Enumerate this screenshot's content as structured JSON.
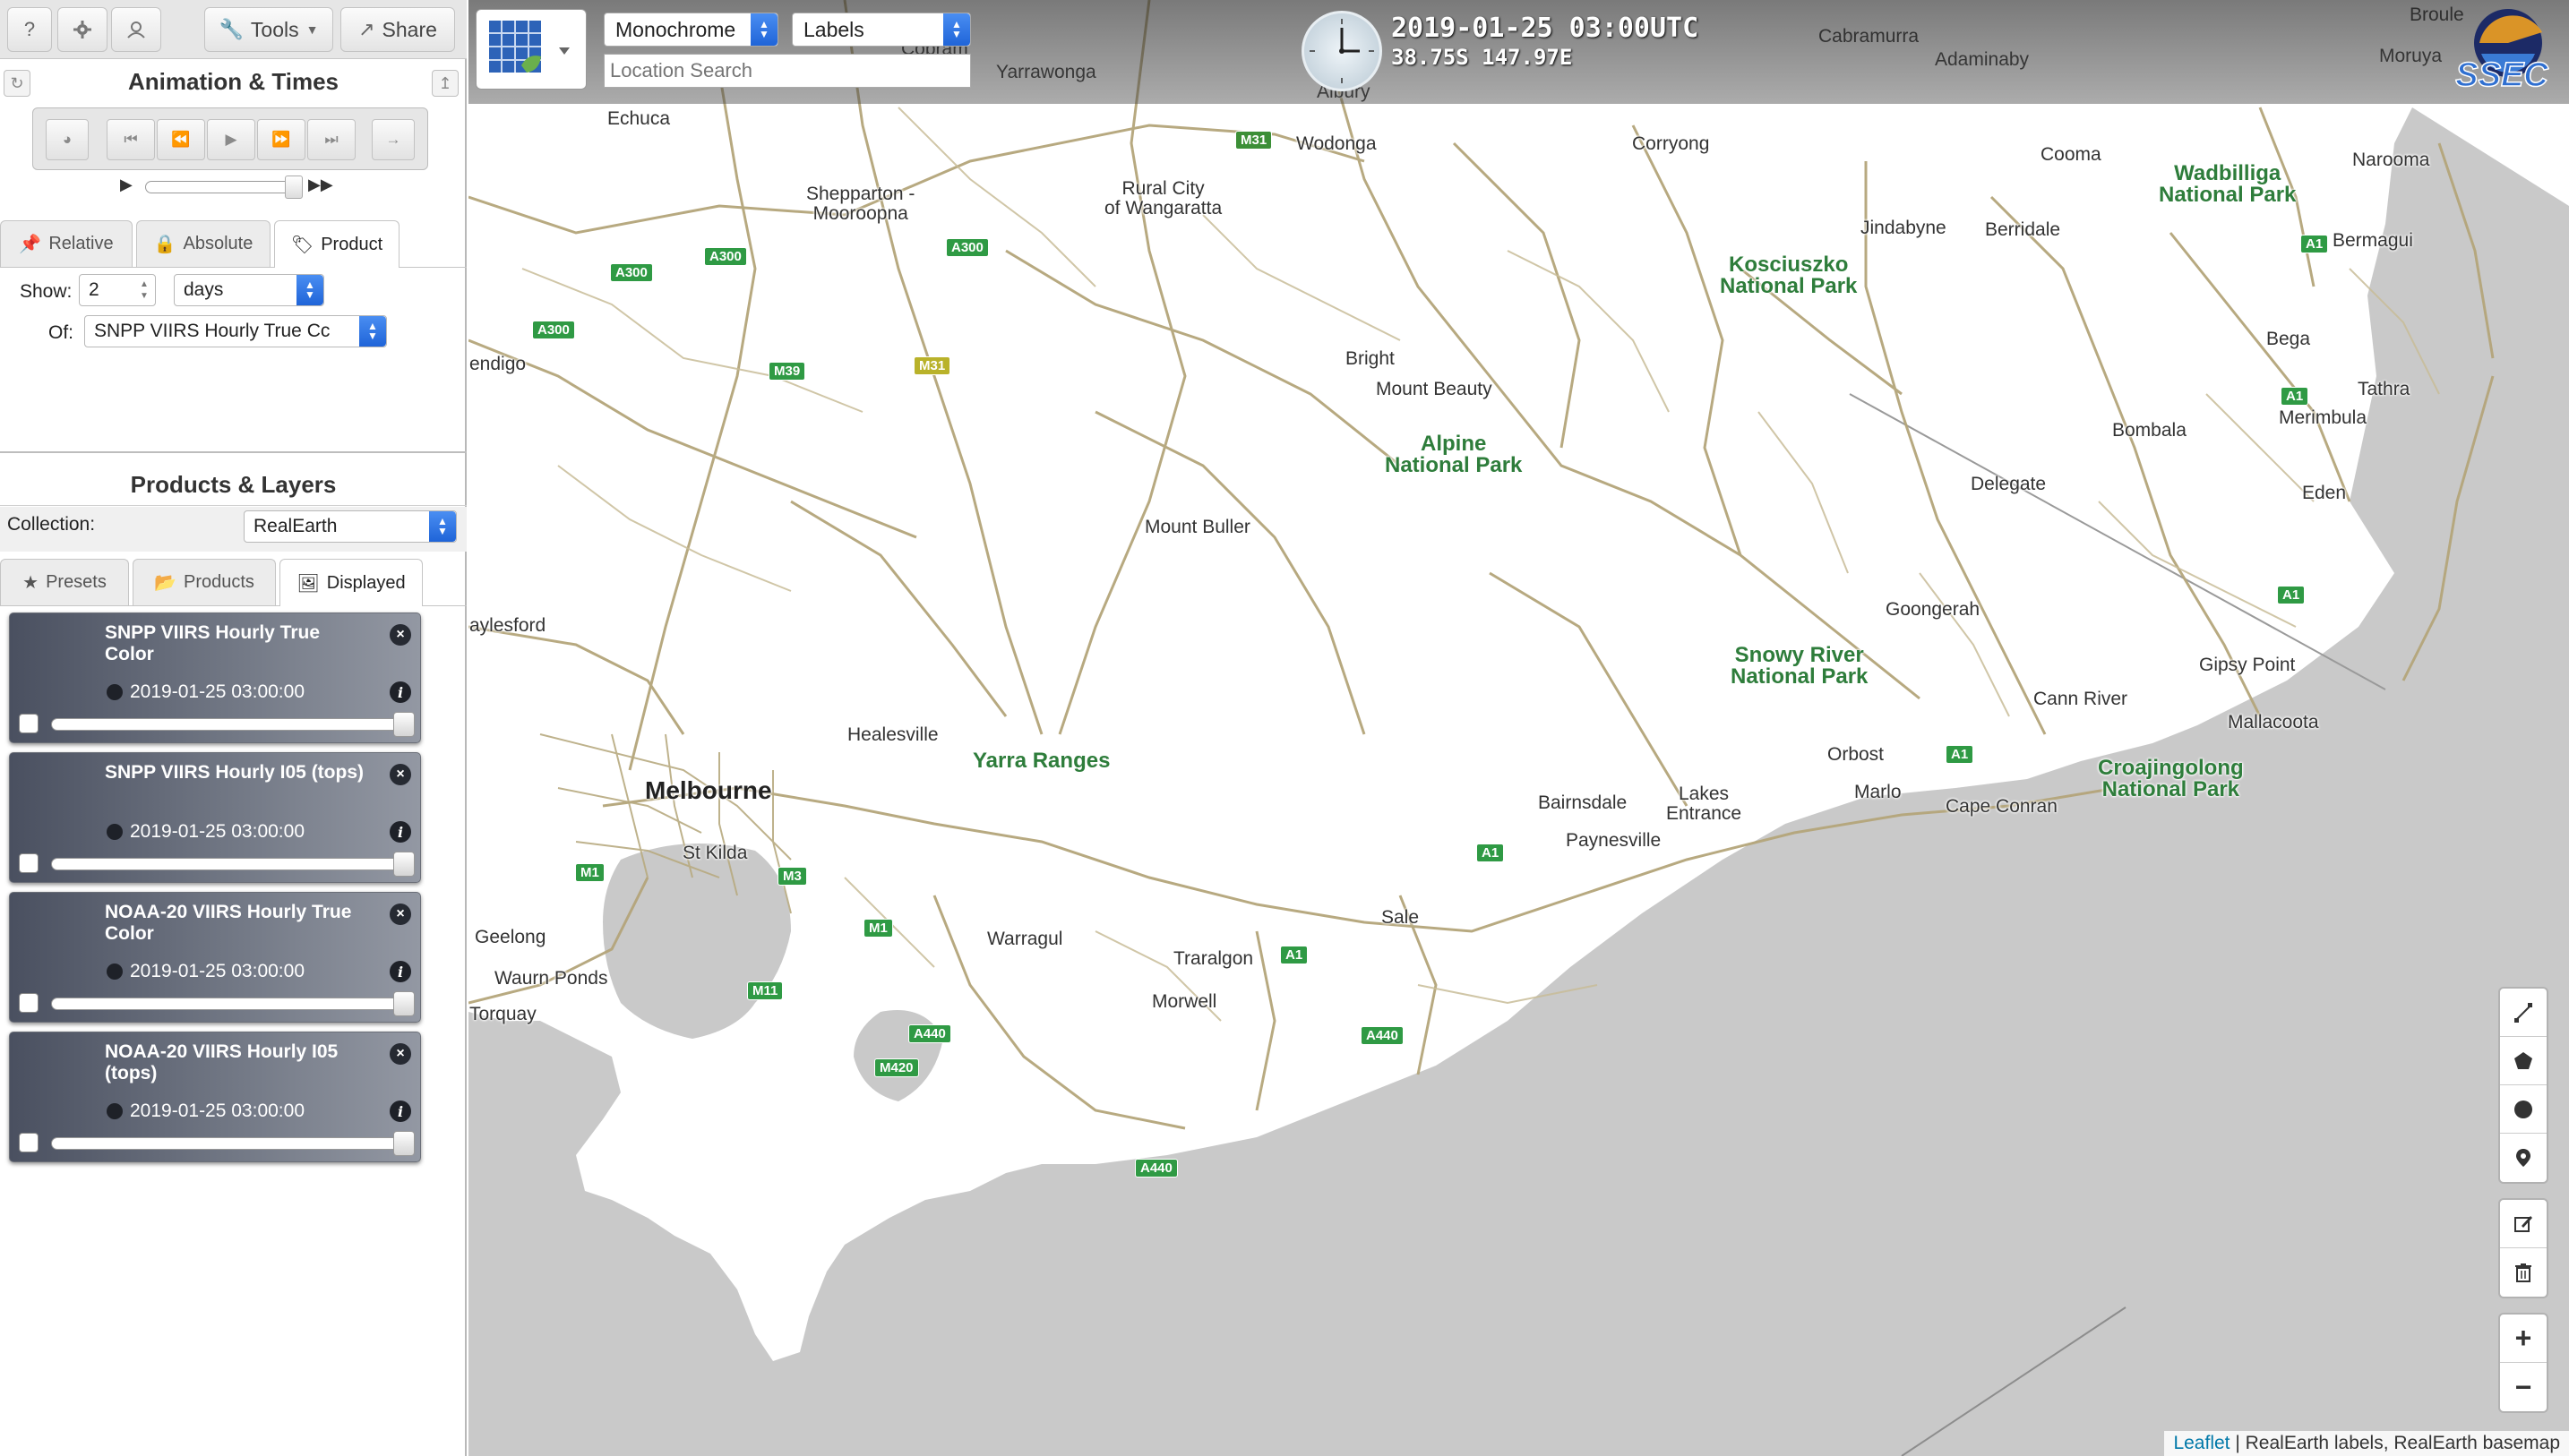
{
  "sidebar": {
    "topbar": {
      "help": "?",
      "tools": "Tools",
      "share": "Share"
    },
    "animation": {
      "title": "Animation & Times",
      "time_tabs": [
        "Relative",
        "Absolute",
        "Product"
      ],
      "show_label": "Show:",
      "show_value": "2",
      "show_unit": "days",
      "of_label": "Of:",
      "of_value": "SNPP VIIRS Hourly True Cc"
    },
    "products": {
      "title": "Products & Layers",
      "collection_label": "Collection:",
      "collection_value": "RealEarth",
      "tabs": [
        "Presets",
        "Products",
        "Displayed"
      ],
      "layers": [
        {
          "title": "SNPP VIIRS Hourly True Color",
          "time": "2019-01-25 03:00:00"
        },
        {
          "title": "SNPP VIIRS Hourly I05 (tops)",
          "time": "2019-01-25 03:00:00"
        },
        {
          "title": "NOAA-20 VIIRS Hourly True Color",
          "time": "2019-01-25 03:00:00"
        },
        {
          "title": "NOAA-20 VIIRS Hourly I05 (tops)",
          "time": "2019-01-25 03:00:00"
        }
      ]
    }
  },
  "map": {
    "basemap_select": "Monochrome",
    "labels_select": "Labels",
    "location_placeholder": "Location Search",
    "datetime": "2019-01-25 03:00UTC",
    "coords": "38.75S 147.97E",
    "logo": "SSEC",
    "attribution": {
      "link": "Leaflet",
      "text": " | RealEarth labels, RealEarth basemap"
    },
    "places": [
      [
        "Cabramurra",
        2030,
        30,
        ""
      ],
      [
        "Adaminaby",
        2160,
        56,
        ""
      ],
      [
        "Moruya",
        2656,
        52,
        ""
      ],
      [
        "Broule",
        2690,
        6,
        ""
      ],
      [
        "Albury",
        1470,
        92,
        ""
      ],
      [
        "Wodonga",
        1447,
        150,
        ""
      ],
      [
        "Corryong",
        1822,
        150,
        ""
      ],
      [
        "Cooma",
        2278,
        162,
        ""
      ],
      [
        "Narooma",
        2626,
        168,
        ""
      ],
      [
        "Echuca",
        678,
        122,
        ""
      ],
      [
        "Yarrawonga",
        1112,
        70,
        ""
      ],
      [
        "Cobram",
        1006,
        44,
        ""
      ],
      [
        "Shepparton - Mooroopna",
        900,
        206,
        "two"
      ],
      [
        "Rural City of Wangaratta",
        1233,
        200,
        "two"
      ],
      [
        "Jindabyne",
        2077,
        244,
        ""
      ],
      [
        "Berridale",
        2216,
        246,
        ""
      ],
      [
        "Bermagui",
        2604,
        258,
        ""
      ],
      [
        "Bright",
        1502,
        390,
        ""
      ],
      [
        "Mount Beauty",
        1536,
        424,
        ""
      ],
      [
        "Bega",
        2530,
        368,
        ""
      ],
      [
        "Tathra",
        2632,
        424,
        ""
      ],
      [
        "Merimbula",
        2544,
        456,
        ""
      ],
      [
        "endigo",
        524,
        396,
        ""
      ],
      [
        "Bombala",
        2358,
        470,
        ""
      ],
      [
        "Delegate",
        2200,
        530,
        ""
      ],
      [
        "Eden",
        2570,
        540,
        ""
      ],
      [
        "Mount Buller",
        1278,
        578,
        ""
      ],
      [
        "aylesford",
        524,
        688,
        ""
      ],
      [
        "Goongerah",
        2105,
        670,
        ""
      ],
      [
        "Gipsy Point",
        2455,
        732,
        ""
      ],
      [
        "Cann River",
        2270,
        770,
        ""
      ],
      [
        "Mallacoota",
        2487,
        796,
        ""
      ],
      [
        "Healesville",
        946,
        810,
        ""
      ],
      [
        "Orbost",
        2040,
        832,
        ""
      ],
      [
        "Marlo",
        2070,
        874,
        ""
      ],
      [
        "Cape Conran",
        2172,
        890,
        ""
      ],
      [
        "Bairnsdale",
        1717,
        886,
        ""
      ],
      [
        "Lakes Entrance",
        1860,
        876,
        "two"
      ],
      [
        "Paynesville",
        1748,
        928,
        ""
      ],
      [
        "St Kilda",
        762,
        942,
        ""
      ],
      [
        "Geelong",
        530,
        1036,
        ""
      ],
      [
        "Waurn Ponds",
        552,
        1082,
        ""
      ],
      [
        "Torquay",
        524,
        1122,
        ""
      ],
      [
        "Warragul",
        1102,
        1038,
        ""
      ],
      [
        "Traralgon",
        1310,
        1060,
        ""
      ],
      [
        "Morwell",
        1286,
        1108,
        ""
      ],
      [
        "Sale",
        1542,
        1014,
        ""
      ]
    ],
    "cities": [
      [
        "Melbourne",
        720,
        872
      ]
    ],
    "parks": [
      [
        "Wadbilliga National Park",
        2410,
        182
      ],
      [
        "Kosciuszko National Park",
        1920,
        284
      ],
      [
        "Alpine National Park",
        1546,
        484
      ],
      [
        "Snowy River National Park",
        1932,
        720
      ],
      [
        "Yarra Ranges",
        1086,
        838
      ],
      [
        "Croajingolong National Park",
        2342,
        846
      ]
    ],
    "shields": [
      [
        "M31",
        1379,
        146,
        "m"
      ],
      [
        "A300",
        681,
        294,
        ""
      ],
      [
        "A300",
        786,
        276,
        ""
      ],
      [
        "A300",
        1056,
        266,
        ""
      ],
      [
        "A300",
        594,
        358,
        ""
      ],
      [
        "M39",
        858,
        404,
        ""
      ],
      [
        "M31",
        1020,
        398,
        "y"
      ],
      [
        "A1",
        2568,
        262,
        ""
      ],
      [
        "A1",
        2546,
        432,
        ""
      ],
      [
        "A1",
        2542,
        654,
        ""
      ],
      [
        "A1",
        2172,
        832,
        ""
      ],
      [
        "A1",
        1648,
        942,
        ""
      ],
      [
        "A1",
        1429,
        1056,
        ""
      ],
      [
        "M1",
        642,
        964,
        ""
      ],
      [
        "M3",
        868,
        968,
        ""
      ],
      [
        "M1",
        964,
        1026,
        ""
      ],
      [
        "M11",
        834,
        1096,
        ""
      ],
      [
        "A440",
        1014,
        1144,
        ""
      ],
      [
        "M420",
        976,
        1182,
        ""
      ],
      [
        "A440",
        1519,
        1146,
        ""
      ],
      [
        "A440",
        1267,
        1294,
        ""
      ]
    ]
  },
  "colors": {
    "accent": "#2b6fe0",
    "park": "#2e7d3b",
    "water": "#c9c9c9",
    "land": "#ffffff",
    "road": "#b4a57a"
  }
}
